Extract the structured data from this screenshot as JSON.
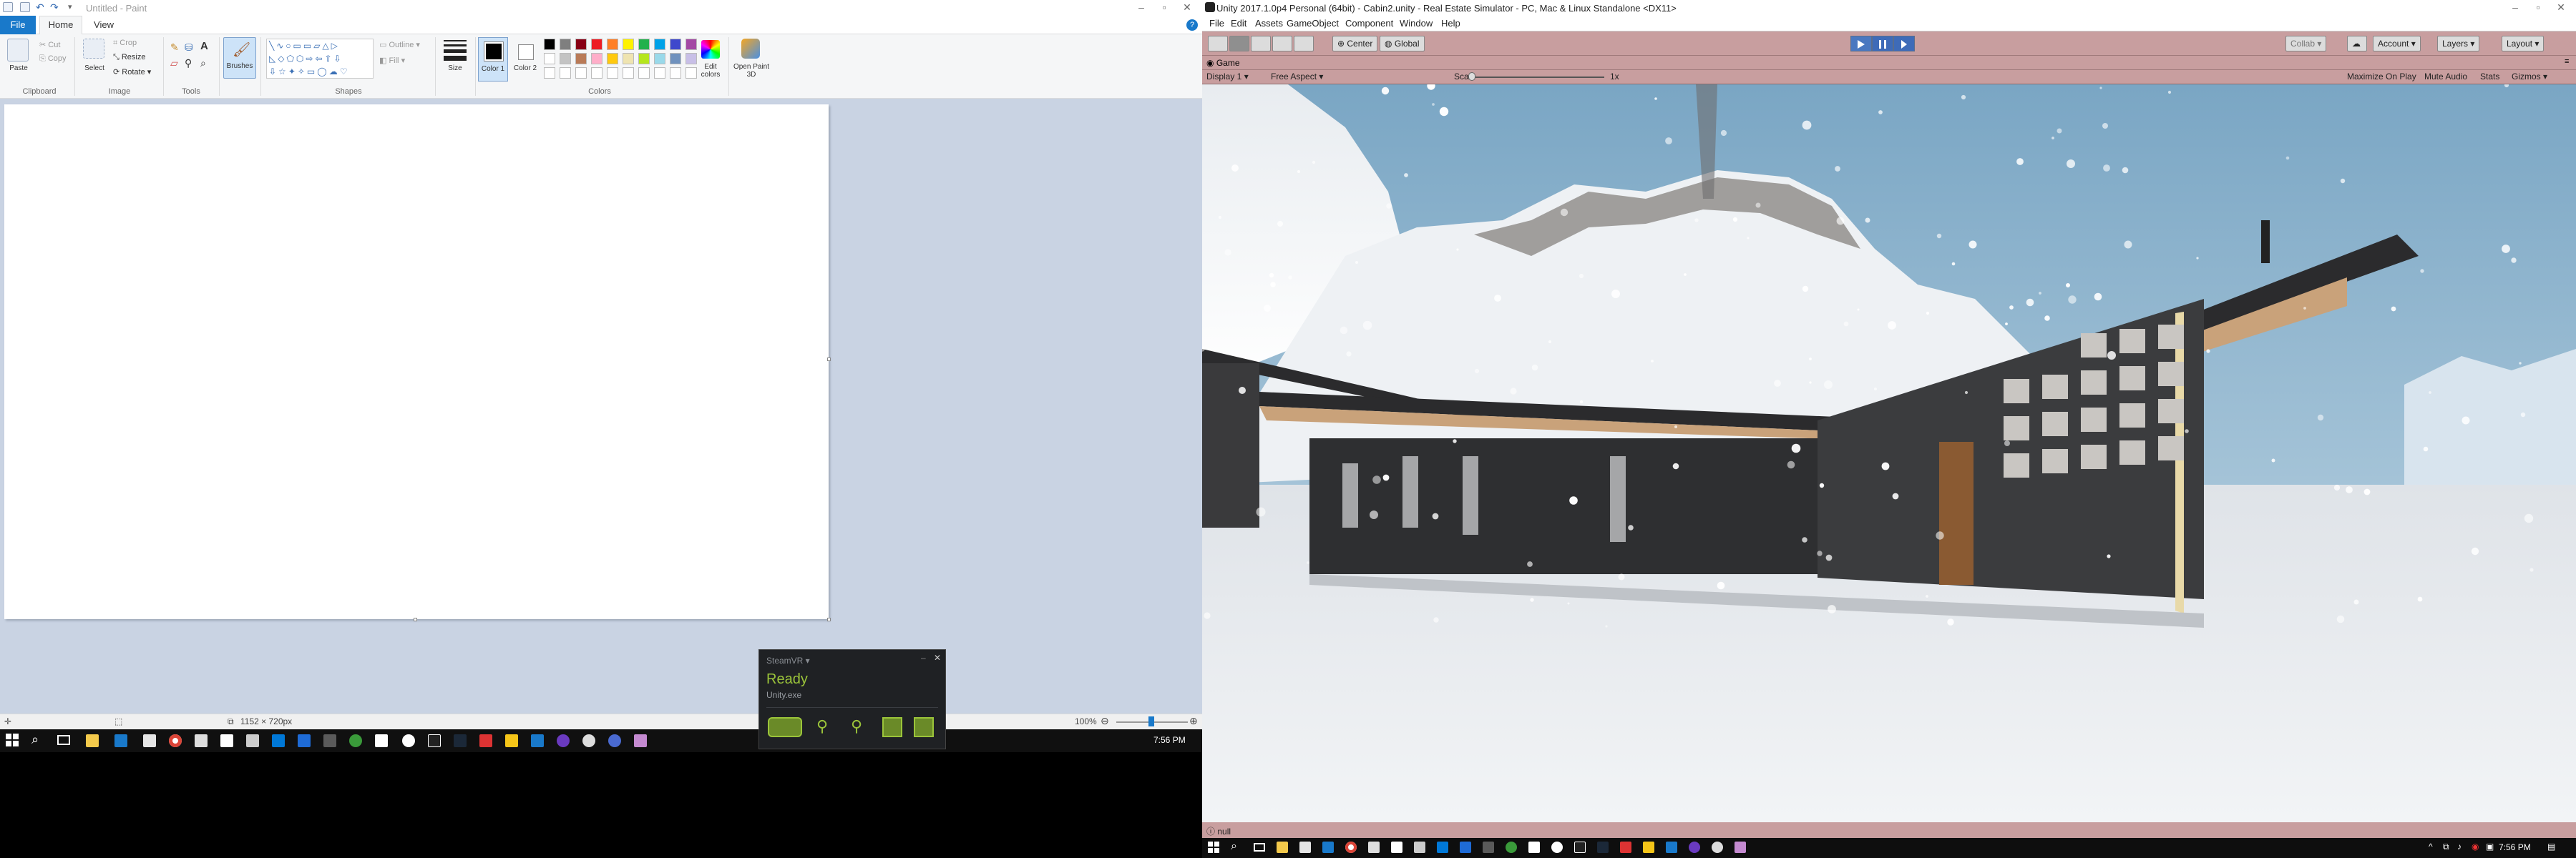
{
  "paint": {
    "title": "Untitled - Paint",
    "tabs": [
      "File",
      "Home",
      "View"
    ],
    "clipboard": {
      "paste": "Paste",
      "cut": "Cut",
      "copy": "Copy",
      "group": "Clipboard"
    },
    "image": {
      "select": "Select",
      "crop": "Crop",
      "resize": "Resize",
      "rotate": "Rotate",
      "group": "Image"
    },
    "tools": {
      "group": "Tools",
      "text_tool": "A"
    },
    "brushes": "Brushes",
    "shapes": {
      "group": "Shapes",
      "outline": "Outline",
      "fill": "Fill"
    },
    "size": "Size",
    "color1": "Color 1",
    "color2": "Color 2",
    "colors_group": "Colors",
    "edit_colors": "Edit colors",
    "open_paint3d": "Open Paint 3D",
    "palette": [
      "#000000",
      "#7f7f7f",
      "#880015",
      "#ed1c24",
      "#ff7f27",
      "#fff200",
      "#22b14c",
      "#00a2e8",
      "#3f48cc",
      "#a349a4",
      "#ffffff",
      "#c3c3c3",
      "#b97a57",
      "#ffaec9",
      "#ffc90e",
      "#efe4b0",
      "#b5e61d",
      "#99d9ea",
      "#7092be",
      "#c8bfe7"
    ],
    "status": {
      "dimensions": "1152 × 720px",
      "zoom": "100%"
    }
  },
  "left_taskbar": {
    "time": "7:56 PM"
  },
  "steamvr": {
    "title": "SteamVR ▾",
    "status": "Ready",
    "app": "Unity.exe",
    "accent": "#9bc43a"
  },
  "unity": {
    "title": "Unity 2017.1.0p4 Personal (64bit) - Cabin2.unity - Real Estate Simulator - PC, Mac & Linux Standalone <DX11>",
    "menu": [
      "File",
      "Edit",
      "Assets",
      "GameObject",
      "Component",
      "Window",
      "Help"
    ],
    "toolbar": {
      "center": "Center",
      "global": "Global",
      "collab": "Collab ▾",
      "account": "Account ▾",
      "layers": "Layers ▾",
      "layout": "Layout ▾"
    },
    "game_tab": "Game",
    "game_controls": {
      "display": "Display 1",
      "aspect": "Free Aspect",
      "scale_label": "Scale",
      "scale_value": "1x",
      "maximize": "Maximize On Play",
      "mute": "Mute Audio",
      "stats": "Stats",
      "gizmos": "Gizmos ▾"
    },
    "status": "null",
    "tint": "#c89e9f"
  },
  "right_taskbar": {
    "time": "7:56 PM"
  }
}
